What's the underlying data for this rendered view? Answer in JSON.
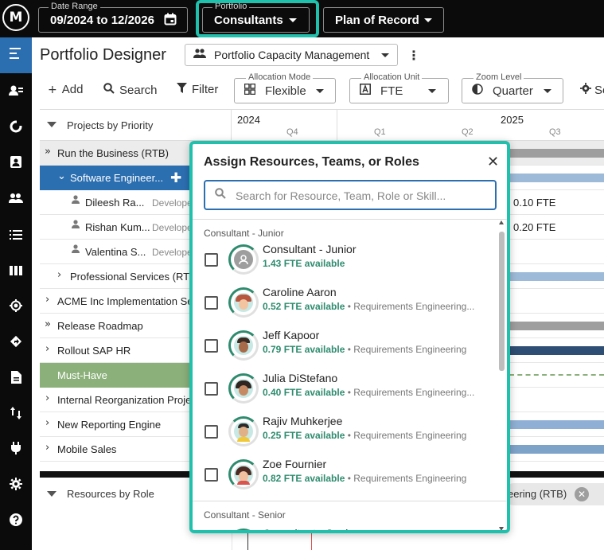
{
  "app": {
    "logo_text": "M"
  },
  "topbar": {
    "date_range": {
      "label": "Date Range",
      "value": "09/2024 to 12/2026"
    },
    "portfolio": {
      "label": "Portfolio",
      "value": "Consultants"
    },
    "plan": {
      "value": "Plan of Record"
    }
  },
  "header": {
    "title": "Portfolio Designer",
    "view": "Portfolio Capacity Management"
  },
  "toolbar": {
    "add": "Add",
    "search": "Search",
    "filter": "Filter",
    "allocation_mode": {
      "label": "Allocation Mode",
      "value": "Flexible"
    },
    "allocation_unit": {
      "label": "Allocation Unit",
      "value": "FTE"
    },
    "zoom_level": {
      "label": "Zoom Level",
      "value": "Quarter"
    },
    "settings_partial": "Se"
  },
  "grid": {
    "left_header": "Projects by Priority",
    "years": [
      "2024",
      "2025"
    ],
    "quarters": [
      "Q4",
      "Q1",
      "Q2",
      "Q3"
    ],
    "rows": [
      {
        "label": "Run the Business (RTB)"
      },
      {
        "label": "Software Engineer..."
      },
      {
        "label": "Dileesh Ra...",
        "role": "Develope",
        "fte": "0.10 FTE"
      },
      {
        "label": "Rishan Kum...",
        "role": "Develope",
        "fte": "0.20 FTE"
      },
      {
        "label": "Valentina S...",
        "role": "Develope"
      },
      {
        "label": "Professional Services (RT"
      },
      {
        "label": "ACME Inc Implementation Se"
      },
      {
        "label": "Release Roadmap"
      },
      {
        "label": "Rollout SAP HR"
      },
      {
        "label": "Must-Have"
      },
      {
        "label": "Internal Reorganization Proje"
      },
      {
        "label": "New Reporting Engine"
      },
      {
        "label": "Mobile Sales"
      }
    ]
  },
  "bottom": {
    "header": "Resources by Role",
    "chip": "eering (RTB)"
  },
  "popup": {
    "title": "Assign Resources, Teams, or Roles",
    "search_placeholder": "Search for Resource, Team, Role or Skill...",
    "groups": [
      {
        "name": "Consultant - Junior",
        "items": [
          {
            "name": "Consultant - Junior",
            "available": "1.43 FTE available",
            "skill": ""
          },
          {
            "name": "Caroline Aaron",
            "available": "0.52 FTE available",
            "skill": "• Requirements Engineering..."
          },
          {
            "name": "Jeff Kapoor",
            "available": "0.79 FTE available",
            "skill": "• Requirements Engineering"
          },
          {
            "name": "Julia DiStefano",
            "available": "0.40 FTE available",
            "skill": "• Requirements Engineering..."
          },
          {
            "name": "Rajiv Muhkerjee",
            "available": "0.25 FTE available",
            "skill": "• Requirements Engineering"
          },
          {
            "name": "Zoe Fournier",
            "available": "0.82 FTE available",
            "skill": "• Requirements Engineering"
          }
        ]
      },
      {
        "name": "Consultant - Senior",
        "items": [
          {
            "name": "Consultant - Senior"
          }
        ]
      }
    ]
  },
  "colors": {
    "accent_teal": "#1fc1ad",
    "selected_blue": "#2c6fb1",
    "must_have_green": "#8bb07a",
    "available_green": "#2e8b6e"
  }
}
